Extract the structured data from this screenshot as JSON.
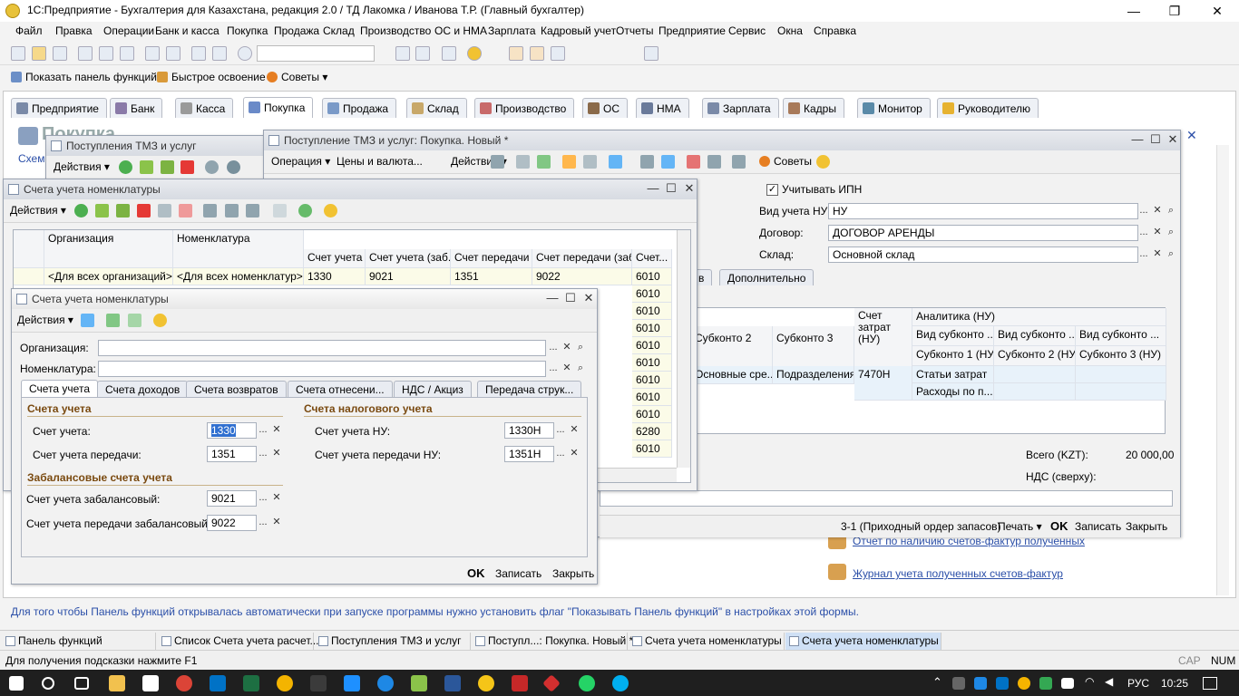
{
  "window": {
    "title": "1С:Предприятие - Бухгалтерия для Казахстана, редакция 2.0 / ТД Лакомка / Иванова Т.Р. (Главный бухгалтер)"
  },
  "menu": [
    "Файл",
    "Правка",
    "Операции",
    "Банк и касса",
    "Покупка",
    "Продажа",
    "Склад",
    "Производство",
    "ОС и НМА",
    "Зарплата",
    "Кадровый учет",
    "Отчеты",
    "Предприятие",
    "Сервис",
    "Окна",
    "Справка"
  ],
  "toolbar2": {
    "show_panel": "Показать панель функций",
    "quick": "Быстрое освоение",
    "tips": "Советы"
  },
  "section_tabs": [
    "Предприятие",
    "Банк",
    "Касса",
    "Покупка",
    "Продажа",
    "Склад",
    "Производство",
    "ОС",
    "НМА",
    "Зарплата",
    "Кадры",
    "Монитор",
    "Руководителю"
  ],
  "panel": {
    "title": "Покупка",
    "scheme": "Схем"
  },
  "win_list_tmz": {
    "title": "Поступления ТМЗ и услуг",
    "actions": "Действия"
  },
  "win_doc": {
    "title": "Поступление ТМЗ и услуг: Покупка. Новый *",
    "operation": "Операция",
    "prices": "Цены и валюта...",
    "actions": "Действия",
    "tips": "Советы",
    "ipn_label": "Учитывать ИПН",
    "vid_nu_label": "Вид учета НУ:",
    "vid_nu_value": "НУ",
    "contract_label": "Договор:",
    "contract_value": "ДОГОВОР АРЕНДЫ",
    "warehouse_label": "Склад:",
    "warehouse_value": "Основной склад",
    "tab_partial": "в",
    "tab_extra": "Дополнительно",
    "grid_headers": {
      "subkonto2": "Субконто 2",
      "subkonto3": "Субконто 3",
      "schet_zatrat": "Счет затрат (НУ)",
      "analytics": "Аналитика (НУ)",
      "vid1": "Вид субконто ...",
      "vid2": "Вид субконто ...",
      "vid3": "Вид субконто ...",
      "sub1": "Субконто 1 (НУ)",
      "sub2": "Субконто 2 (НУ)",
      "sub3": "Субконто 3 (НУ)"
    },
    "grid_row": {
      "subkonto2": "Основные сре...",
      "subkonto3": "Подразделения",
      "schet": "7470Н",
      "vid1": "Статьи затрат",
      "sub1": "Расходы по п..."
    },
    "total_label": "Всего (KZT):",
    "total_value": "20 000,00",
    "vat_label": "НДС (сверху):",
    "footer": {
      "order": "3-1 (Приходный ордер запасов)",
      "print": "Печать",
      "ok": "OK",
      "save": "Записать",
      "close": "Закрыть"
    }
  },
  "win_accounts_list": {
    "title": "Счета учета номенклатуры",
    "actions": "Действия",
    "headers": {
      "org": "Организация",
      "nom": "Номенклатура",
      "schet": "Счет учета",
      "schet_zab": "Счет учета (заб.)",
      "peredachi": "Счет передачи",
      "peredachi_zab": "Счет передачи (заб.)",
      "schet_short": "Счет..."
    },
    "row1": {
      "org": "<Для всех организаций>",
      "nom": "<Для всех номенклатур>",
      "schet": "1330",
      "schet_zab": "9021",
      "peredachi": "1351",
      "peredachi_zab": "9022",
      "last": "6010"
    },
    "col_values": [
      "6010",
      "6010",
      "6010",
      "6010",
      "6010",
      "6010",
      "6010",
      "6010",
      "6280",
      "6010"
    ]
  },
  "win_accounts_form": {
    "title": "Счета учета номенклатуры",
    "actions": "Действия",
    "org_label": "Организация:",
    "nom_label": "Номенклатура:",
    "tabs": [
      "Счета учета",
      "Счета доходов",
      "Счета возвратов",
      "Счета отнесени...",
      "НДС / Акциз",
      "Передача струк..."
    ],
    "sec_accounts": "Счета учета",
    "sec_tax": "Счета налогового учета",
    "sec_offbalance": "Забалансовые счета учета",
    "schet_label": "Счет учета:",
    "schet_value": "1330",
    "peredachi_label": "Счет учета передачи:",
    "peredachi_value": "1351",
    "nu_label": "Счет учета НУ:",
    "nu_value": "1330Н",
    "nu_peredachi_label": "Счет учета передачи НУ:",
    "nu_peredachi_value": "1351Н",
    "zab_label": "Счет учета забалансовый:",
    "zab_value": "9021",
    "zab_peredachi_label": "Счет учета передачи забалансовый:",
    "zab_peredachi_value": "9022",
    "ok": "OK",
    "save": "Записать",
    "close": "Закрыть"
  },
  "panel_links": {
    "link1": "Отчет по наличию счетов-фактур полученных",
    "link2": "Журнал учета полученных счетов-фактур"
  },
  "hint": "Для того чтобы Панель функций открывалась автоматически при запуске программы нужно установить флаг \"Показывать Панель функций\" в настройках этой формы.",
  "taskwindows": [
    "Панель функций",
    "Список Счета учета расчет...",
    "Поступления ТМЗ и услуг",
    "Поступл...: Покупка. Новый *",
    "Счета учета номенклатуры",
    "Счета учета номенклатуры"
  ],
  "status": {
    "hint": "Для получения подсказки нажмите F1",
    "cap": "CAP",
    "num": "NUM"
  },
  "tray": {
    "lang": "РУС",
    "time": "10:25"
  }
}
